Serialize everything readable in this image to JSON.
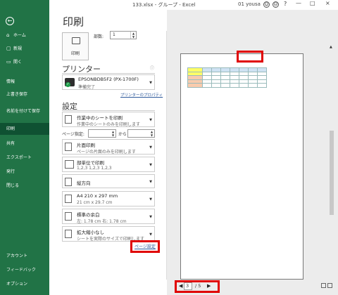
{
  "titlebar": {
    "title": "133.xlsx - グループ - Excel",
    "user": "01 yousa",
    "help": "?",
    "min": "—",
    "max": "□",
    "close": "×"
  },
  "nav": {
    "back": "←",
    "items": [
      {
        "label": "ホーム",
        "icon": "⌂"
      },
      {
        "label": "新規",
        "icon": "▢"
      },
      {
        "label": "開く",
        "icon": "▭"
      },
      {
        "label": "情報"
      },
      {
        "label": "上書き保存"
      },
      {
        "label": "名前を付けて保存"
      },
      {
        "label": "印刷"
      },
      {
        "label": "共有"
      },
      {
        "label": "エクスポート"
      },
      {
        "label": "発行"
      },
      {
        "label": "閉じる"
      },
      {
        "label": "アカウント"
      },
      {
        "label": "フィードバック"
      },
      {
        "label": "オプション"
      }
    ]
  },
  "print": {
    "heading": "印刷",
    "button": "印刷",
    "copies_label": "部数:",
    "copies_value": "1",
    "printer_heading": "プリンター",
    "printer_name": "EPSONBDB5F2 (PX-1700F)",
    "printer_status": "準備完了",
    "printer_props": "プリンターのプロパティ",
    "settings_heading": "設定",
    "pages_label": "ページ指定:",
    "pages_to": "から",
    "settings": [
      {
        "line1": "作業中のシートを印刷",
        "line2": "作業中のシートのみを印刷します"
      },
      {
        "line1": "片面印刷",
        "line2": "ページの片面のみを印刷します"
      },
      {
        "line1": "部単位で印刷",
        "line2": "1,2,3    1,2,3    1,2,3"
      },
      {
        "line1": "縦方向",
        "line2": ""
      },
      {
        "line1": "A4 210 x 297 mm",
        "line2": "21 cm x 29.7 cm"
      },
      {
        "line1": "標準の余白",
        "line2": "左:  1.78 cm    右:  1.78 cm"
      },
      {
        "line1": "拡大縮小なし",
        "line2": "シートを実際のサイズで印刷します"
      }
    ],
    "page_setup": "ページ設定"
  },
  "preview": {
    "current_page": "3",
    "total_pages": "/ 5",
    "prev": "◀",
    "next": "▶",
    "table": {
      "headers": [
        "",
        "",
        "",
        "",
        "",
        "",
        "",
        ""
      ],
      "rows": [
        [
          "",
          "",
          "",
          "",
          "",
          "",
          "",
          ""
        ],
        [
          "",
          "",
          "",
          "",
          "",
          "",
          "",
          ""
        ],
        [
          "",
          "",
          "",
          "",
          "",
          "",
          "",
          ""
        ],
        [
          "",
          "",
          "",
          "",
          "",
          "",
          "",
          ""
        ]
      ]
    }
  },
  "colors": {
    "nav_green": "#217346",
    "active_green": "#0f5132",
    "highlight_red": "#e00000",
    "link_blue": "#2b579a",
    "header_cell_blue": "#cfe2f3",
    "label_yellow": "#ffff66",
    "label_orange": "#f8cbad"
  }
}
